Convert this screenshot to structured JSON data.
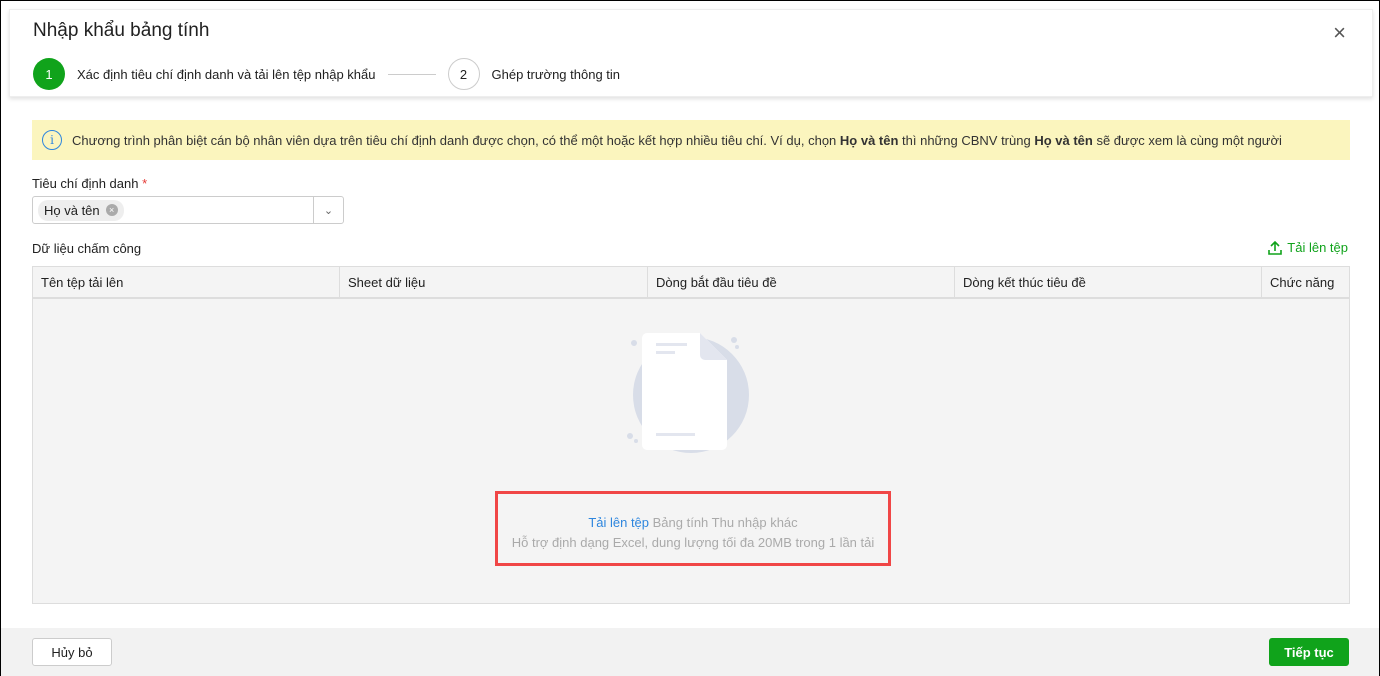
{
  "dialog": {
    "title": "Nhập khẩu bảng tính",
    "close_icon": "×"
  },
  "steps": [
    {
      "number": "1",
      "label": "Xác định tiêu chí định danh và tải lên tệp nhập khẩu"
    },
    {
      "number": "2",
      "label": "Ghép trường thông tin"
    }
  ],
  "banner": {
    "part1": "Chương trình phân biệt cán bộ nhân viên dựa trên tiêu chí định danh được chọn, có thể một hoặc kết hợp nhiều tiêu chí. Ví dụ, chọn ",
    "bold1": "Họ và tên",
    "part2": " thì những CBNV trùng ",
    "bold2": "Họ và tên",
    "part3": " sẽ được xem là cùng một người"
  },
  "criteria": {
    "label": "Tiêu chí định danh",
    "required": "*",
    "selected": "Họ và tên"
  },
  "data_section": {
    "label": "Dữ liệu chấm công",
    "upload_label": "Tải lên tệp"
  },
  "table": {
    "columns": [
      "Tên tệp tải lên",
      "Sheet dữ liệu",
      "Dòng bắt đầu tiêu đề",
      "Dòng kết thúc tiêu đề",
      "Chức năng"
    ]
  },
  "empty": {
    "link": "Tải lên tệp",
    "text": " Bảng tính Thu nhập khác",
    "hint": "Hỗ trợ định dạng Excel, dung lượng tối đa 20MB trong 1 lần tải"
  },
  "footer": {
    "cancel": "Hủy bỏ",
    "next": "Tiếp tục"
  }
}
